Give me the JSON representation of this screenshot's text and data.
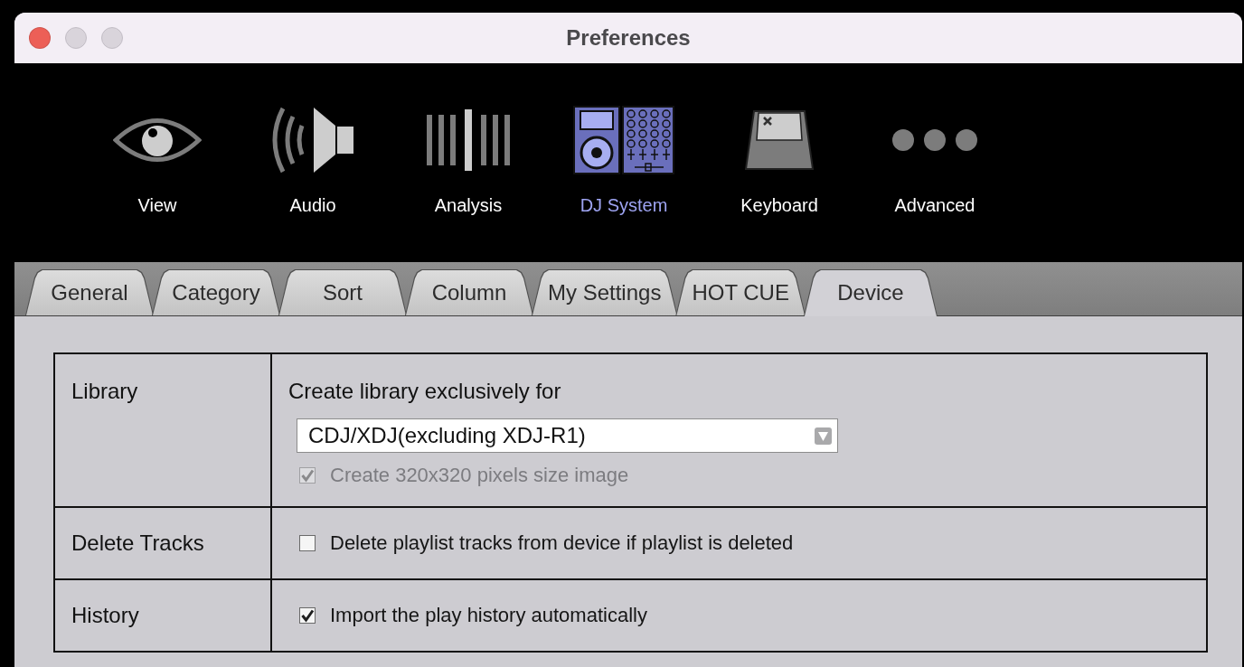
{
  "window": {
    "title": "Preferences",
    "buttons": [
      {
        "kind": "close",
        "disabled": false
      },
      {
        "kind": "minimize",
        "disabled": true
      },
      {
        "kind": "zoom",
        "disabled": true
      }
    ]
  },
  "categories": [
    {
      "label": "View",
      "selected": false
    },
    {
      "label": "Audio",
      "selected": false
    },
    {
      "label": "Analysis",
      "selected": false
    },
    {
      "label": "DJ System",
      "selected": true
    },
    {
      "label": "Keyboard",
      "selected": false
    },
    {
      "label": "Advanced",
      "selected": false
    }
  ],
  "tabs": [
    {
      "label": "General",
      "selected": false
    },
    {
      "label": "Category",
      "selected": false
    },
    {
      "label": "Sort",
      "selected": false
    },
    {
      "label": "Column",
      "selected": false
    },
    {
      "label": "My Settings",
      "selected": false
    },
    {
      "label": "HOT CUE",
      "selected": false
    },
    {
      "label": "Device",
      "selected": true
    }
  ],
  "settings": [
    {
      "label": "Library",
      "heading": "Create library exclusively for",
      "dropdown": {
        "value": "CDJ/XDJ(excluding XDJ-R1)"
      },
      "options": [
        {
          "label": "Create 320x320 pixels size image",
          "checked": true,
          "disabled": true
        }
      ]
    },
    {
      "label": "Delete Tracks",
      "options": [
        {
          "label": "Delete playlist tracks from device if playlist is deleted",
          "checked": false,
          "disabled": false
        }
      ]
    },
    {
      "label": "History",
      "options": [
        {
          "label": "Import the play history automatically",
          "checked": true,
          "disabled": false
        }
      ]
    }
  ]
}
